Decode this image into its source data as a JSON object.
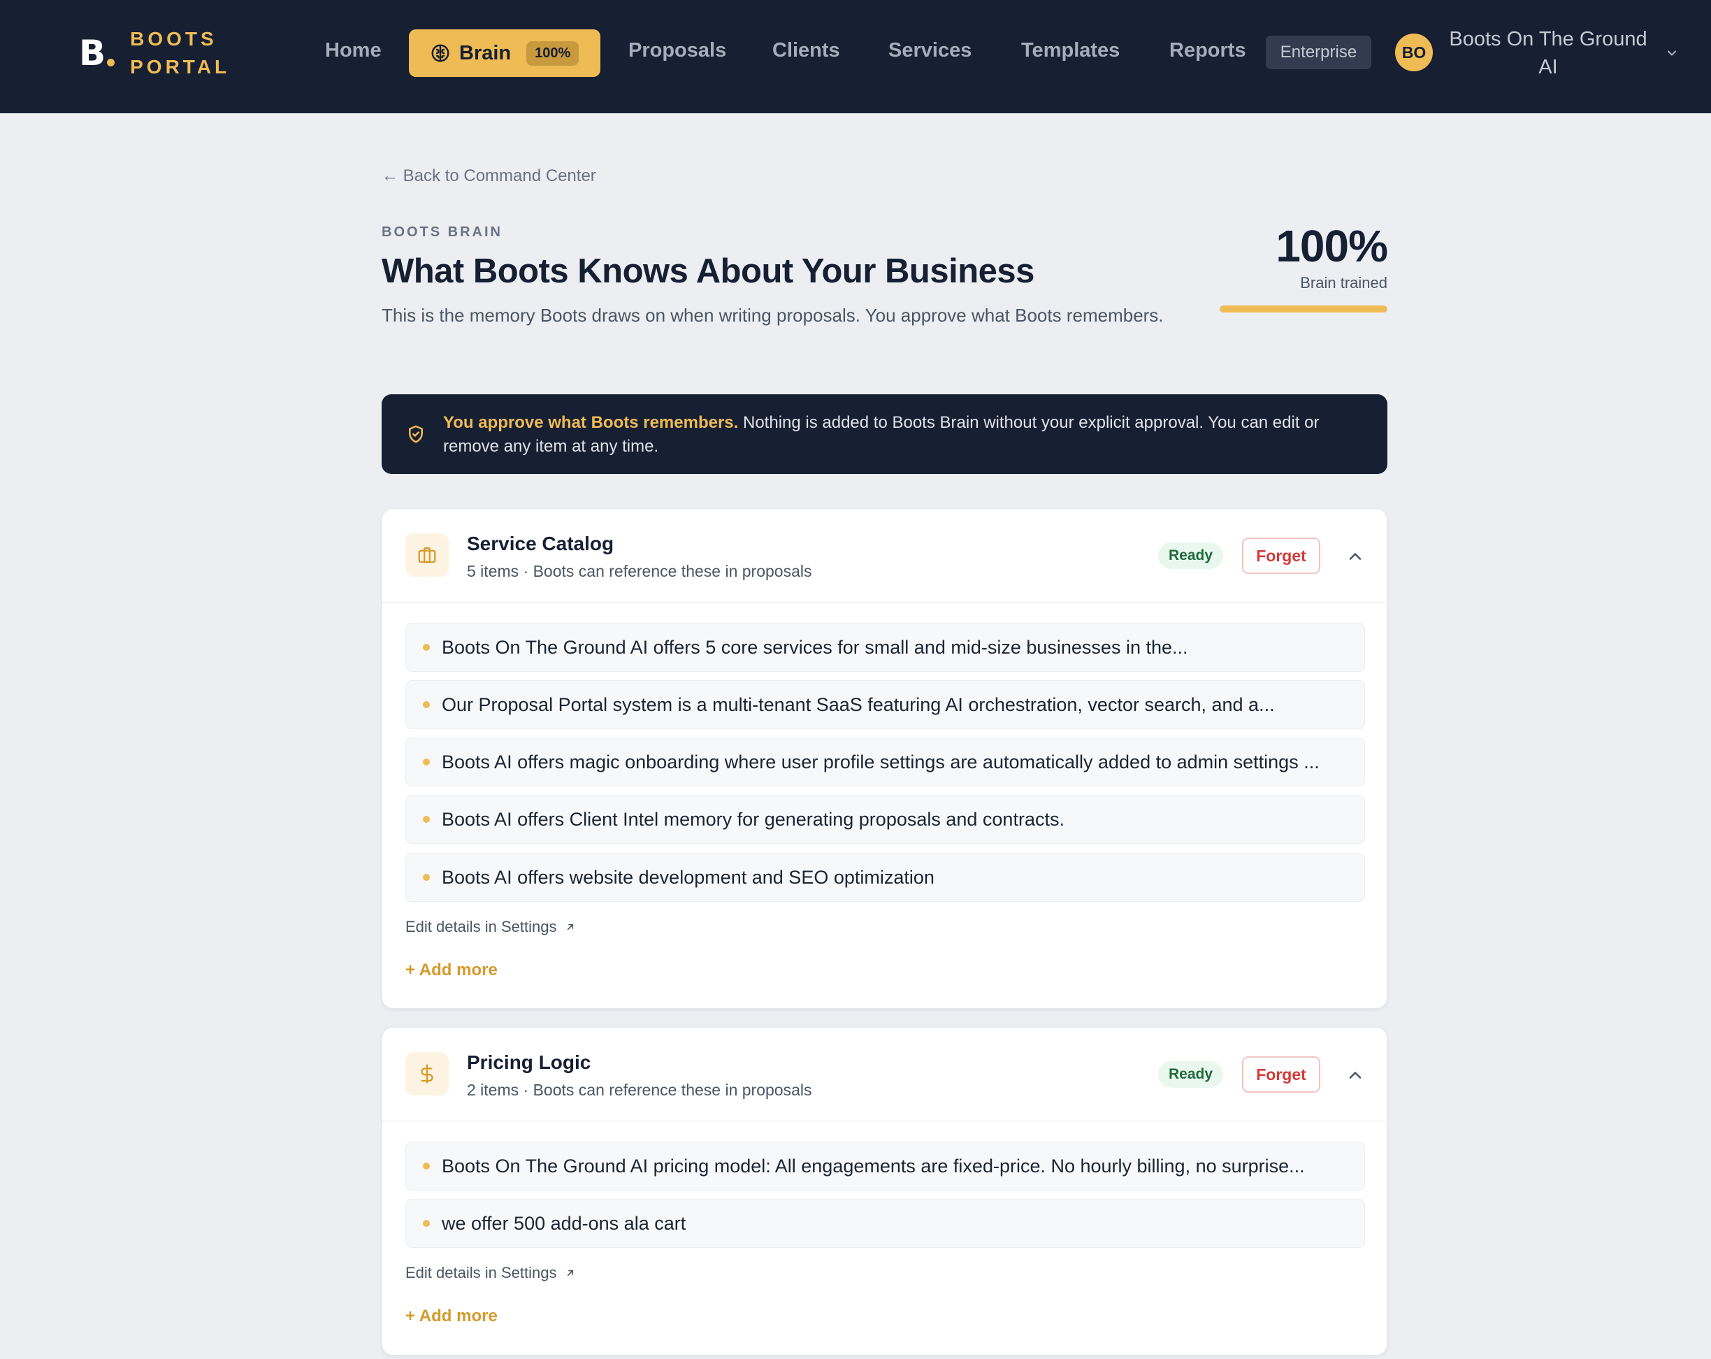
{
  "brand": {
    "logo_mark": "B",
    "line1": "BOOTS",
    "line2": "PORTAL",
    "accent_color": "#efbb54",
    "nav_bg": "#171f33"
  },
  "nav": {
    "home": "Home",
    "brain": "Brain",
    "brain_pct": "100%",
    "proposals": "Proposals",
    "clients": "Clients",
    "services": "Services",
    "templates": "Templates",
    "reports": "Reports",
    "plan_badge": "Enterprise",
    "avatar_initials": "BO",
    "account_name_line1": "Boots On The Ground",
    "account_name_line2": "AI"
  },
  "page": {
    "back_link": "← Back to Command Center",
    "eyebrow": "BOOTS BRAIN",
    "title": "What Boots Knows About Your Business",
    "subtitle": "This is the memory Boots draws on when writing proposals. You approve what Boots remembers.",
    "trained_pct": "100%",
    "trained_label": "Brain trained",
    "trained_fraction": 1.0
  },
  "notice": {
    "strong": "You approve what Boots remembers.",
    "text": " Nothing is added to Boots Brain without your explicit approval. You can edit or remove any item at any time."
  },
  "sections": [
    {
      "icon": "briefcase-icon",
      "title": "Service Catalog",
      "subtitle": "5 items · Boots can reference these in proposals",
      "status": "Ready",
      "forget_label": "Forget",
      "items": [
        "Boots On The Ground AI offers 5 core services for small and mid-size businesses in the...",
        "Our Proposal Portal system is a multi-tenant SaaS featuring AI orchestration, vector search, and a...",
        "Boots AI offers magic onboarding where user profile settings are automatically added to admin settings ...",
        "Boots AI offers Client Intel memory for generating proposals and contracts.",
        "Boots AI offers website development and SEO optimization"
      ],
      "edit_link": "Edit details in Settings",
      "add_more": "+ Add more"
    },
    {
      "icon": "dollar-icon",
      "title": "Pricing Logic",
      "subtitle": "2 items · Boots can reference these in proposals",
      "status": "Ready",
      "forget_label": "Forget",
      "items": [
        "Boots On The Ground AI pricing model: All engagements are fixed-price. No hourly billing, no surprise...",
        "we offer 500 add-ons ala cart"
      ],
      "edit_link": "Edit details in Settings",
      "add_more": "+ Add more"
    }
  ]
}
